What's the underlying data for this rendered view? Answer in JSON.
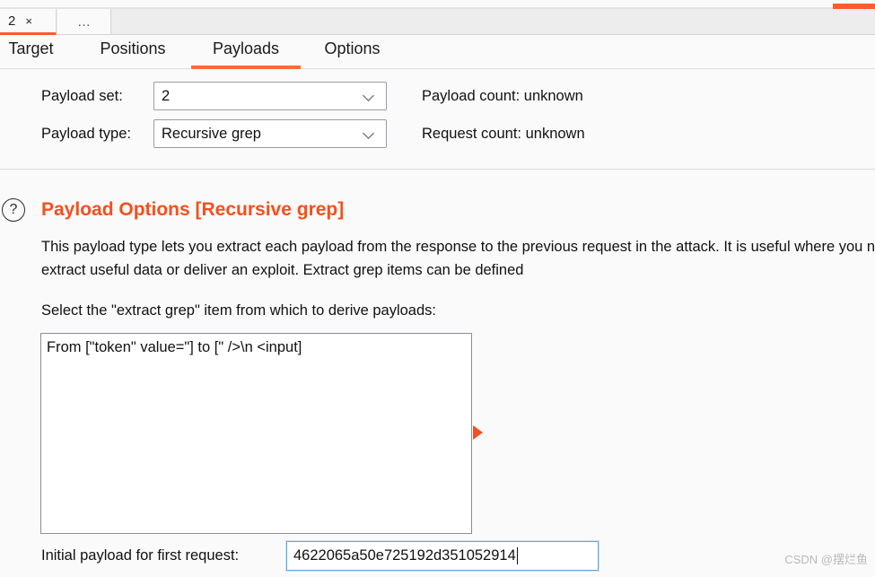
{
  "window": {
    "accent_color": "#ff5c2b",
    "tabs": [
      {
        "label": "2",
        "close": "×",
        "active": true
      },
      {
        "label": "…",
        "active": false
      }
    ]
  },
  "subtabs": [
    {
      "label": "Target",
      "selected": false
    },
    {
      "label": "Positions",
      "selected": false
    },
    {
      "label": "Payloads",
      "selected": true
    },
    {
      "label": "Options",
      "selected": false
    }
  ],
  "payload_sets": {
    "set_label": "Payload set:",
    "set_value": "2",
    "type_label": "Payload type:",
    "type_value": "Recursive grep",
    "payload_count_label": "Payload count:",
    "payload_count_value": "unknown",
    "request_count_label": "Request count:",
    "request_count_value": "unknown"
  },
  "payload_options": {
    "help_icon": "?",
    "heading": "Payload Options [Recursive grep]",
    "heading_color": "#f4501e",
    "description": "This payload type lets you extract each payload from the response to the previous request in the attack. It is useful where you need to work recursively to extract useful data or deliver an exploit. Extract grep items can be defined",
    "select_label": "Select the \"extract grep\" item from which to derive payloads:",
    "grep_items": [
      "From [\"token\" value=\"] to [\" />\\n   <input]"
    ],
    "arrow_icon": "play-arrow-icon"
  },
  "initial_payload": {
    "label": "Initial payload for first request:",
    "value": "4622065a50e725192d351052914"
  },
  "watermark": "CSDN @摆烂鱼"
}
